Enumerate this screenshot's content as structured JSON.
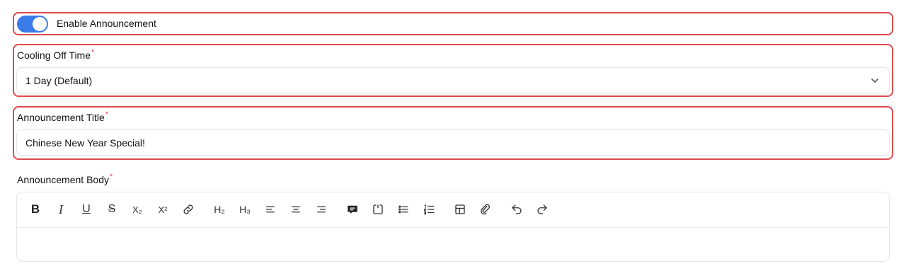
{
  "toggle": {
    "label": "Enable Announcement",
    "enabled": true,
    "accent": "#3b7be8"
  },
  "cooling": {
    "label": "Cooling Off Time",
    "required_mark": "*",
    "value": "1 Day (Default)"
  },
  "title": {
    "label": "Announcement Title",
    "required_mark": "*",
    "value": "Chinese New Year Special!"
  },
  "body": {
    "label": "Announcement Body",
    "required_mark": "*",
    "toolbar": {
      "bold": "B",
      "italic": "I",
      "underline": "U",
      "strike": "S",
      "subscript": "X₂",
      "superscript": "X²",
      "h2": "H₂",
      "h3": "H₃"
    },
    "content": ""
  },
  "highlight_color": "#df4a4f"
}
